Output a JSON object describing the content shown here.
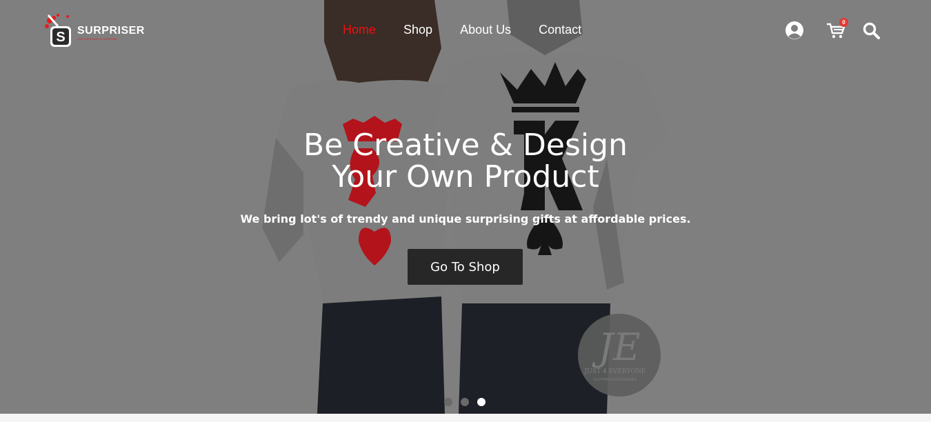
{
  "brand": {
    "name": "SURPRISER",
    "tagline": "LIVE EVERYDAY IN SURPRISE",
    "accent": "#e11d1d"
  },
  "nav": {
    "items": [
      {
        "label": "Home",
        "active": true
      },
      {
        "label": "Shop",
        "active": false
      },
      {
        "label": "About Us",
        "active": false
      },
      {
        "label": "Contact",
        "active": false
      }
    ]
  },
  "header_icons": {
    "account": "user-circle-icon",
    "cart": "cart-icon",
    "cart_count": "0",
    "search": "search-icon"
  },
  "hero": {
    "headline_line1": "Be Creative & Design",
    "headline_line2": "Your Own Product",
    "subtitle": "We bring lot's of trendy and unique surprising gifts at affordable prices.",
    "cta_label": "Go To Shop",
    "slides_total": 3,
    "active_slide": 3,
    "watermark_brand": "JUST 4 EVERYONE",
    "watermark_sub": "CLOTHING ACCESSORIES"
  }
}
